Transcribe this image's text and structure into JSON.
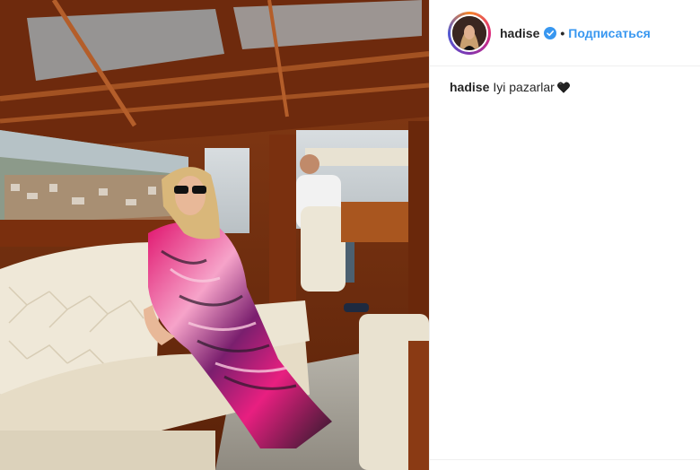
{
  "post": {
    "author": {
      "username": "hadise",
      "verified": true,
      "separator": "•",
      "follow_label": "Подписаться",
      "avatar_icon": "profile-photo"
    },
    "caption": {
      "username": "hadise",
      "text": "Iyi pazarlar",
      "emoji_icon": "black-heart-icon"
    },
    "photo": {
      "subject": "woman-in-pink-kaftan-on-boat"
    }
  },
  "colors": {
    "link_blue": "#3897f0",
    "text": "#262626",
    "border": "#efefef"
  }
}
